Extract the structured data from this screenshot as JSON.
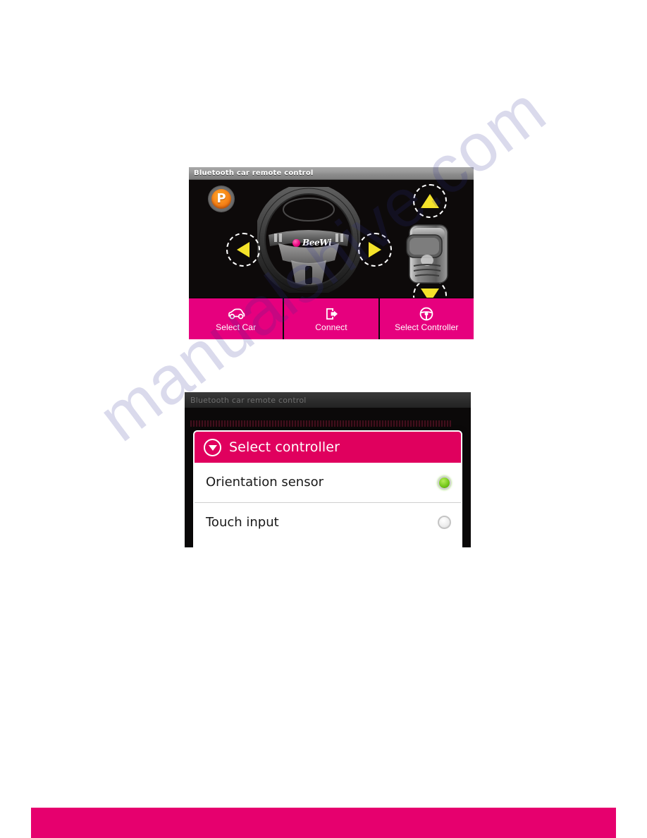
{
  "page": {
    "watermark": "manualshive.com",
    "footer_band_color": "#e6006e"
  },
  "screenshot_app": {
    "title": "Bluetooth car remote control",
    "canvas": {
      "park_button_label": "P",
      "brand_logo_text": "BeeWi",
      "controls": [
        {
          "name": "steer-left",
          "glyph": "left-triangle"
        },
        {
          "name": "steer-right",
          "glyph": "right-triangle"
        },
        {
          "name": "accelerate",
          "glyph": "up-triangle"
        },
        {
          "name": "reverse",
          "glyph": "down-triangle"
        }
      ],
      "pedal_name": "gear-shifter"
    },
    "toolbar": {
      "buttons": [
        {
          "label": "Select Car",
          "icon": "car-icon"
        },
        {
          "label": "Connect",
          "icon": "connect-export-icon"
        },
        {
          "label": "Select Controller",
          "icon": "steering-wheel-icon"
        }
      ],
      "background_color": "#e6007e"
    }
  },
  "screenshot_dialog": {
    "title": "Bluetooth car remote control",
    "dialog": {
      "header_label": "Select controller",
      "header_icon": "chevron-down-circle-icon",
      "header_color": "#e0005e",
      "options": [
        {
          "label": "Orientation sensor",
          "selected": true
        },
        {
          "label": "Touch input",
          "selected": false
        }
      ]
    }
  }
}
